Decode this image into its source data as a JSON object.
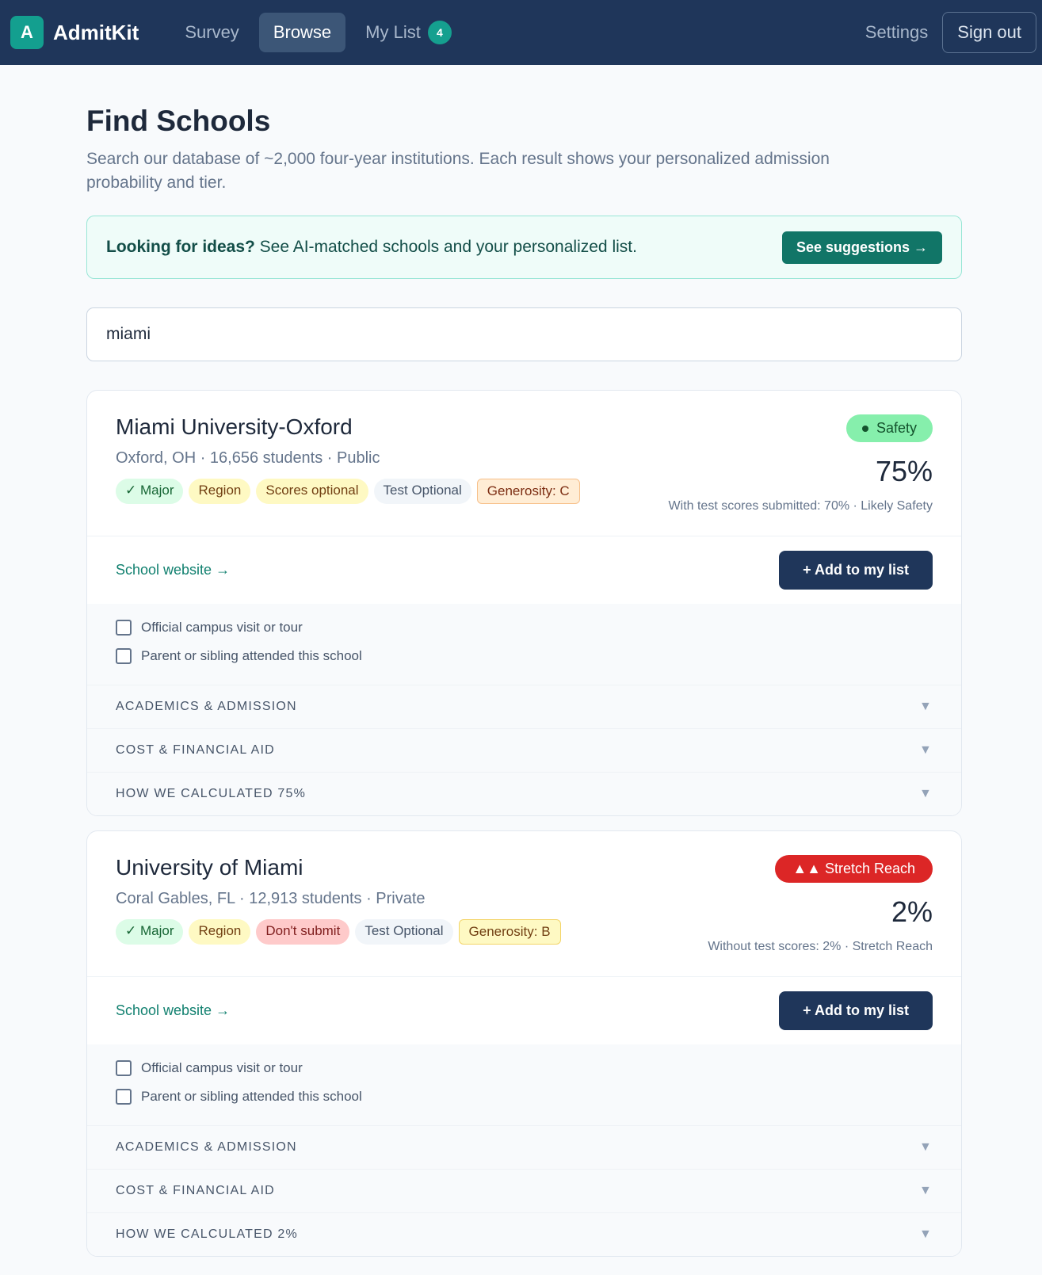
{
  "nav": {
    "logo_letter": "A",
    "brand": "AdmitKit",
    "links": [
      {
        "label": "Survey"
      },
      {
        "label": "Browse"
      },
      {
        "label": "My List",
        "count": "4"
      }
    ],
    "settings": "Settings",
    "signout": "Sign out"
  },
  "page": {
    "title": "Find Schools",
    "subtitle": "Search our database of ~2,000 four-year institutions. Each result shows your personalized admission probability and tier."
  },
  "ideas": {
    "lead": "Looking for ideas?",
    "text": " See AI-matched schools and your personalized list.",
    "button": "See suggestions →"
  },
  "search": {
    "value": "miami"
  },
  "results": [
    {
      "name": "Miami University-Oxford",
      "meta": "Oxford, OH · 16,656 students · Public",
      "tags": [
        "✓ Major",
        "Region",
        "Scores optional",
        "Test Optional",
        "Generosity: C"
      ],
      "tier": "Safety",
      "pct": "75%",
      "note": "With test scores submitted: 70% · Likely Safety",
      "website": "School website →",
      "add": "+ Add to my list",
      "checks": [
        "Official campus visit or tour",
        "Parent or sibling attended this school"
      ],
      "sections": [
        "ACADEMICS & ADMISSION",
        "COST & FINANCIAL AID",
        "HOW WE CALCULATED 75%"
      ],
      "arrow": "▼"
    },
    {
      "name": "University of Miami",
      "meta": "Coral Gables, FL · 12,913 students · Private",
      "tags": [
        "✓ Major",
        "Region",
        "Don't submit",
        "Test Optional",
        "Generosity: B"
      ],
      "tier": "▲▲  Stretch Reach",
      "pct": "2%",
      "note": "Without test scores: 2% · Stretch Reach",
      "website": "School website →",
      "add": "+ Add to my list",
      "checks": [
        "Official campus visit or tour",
        "Parent or sibling attended this school"
      ],
      "sections": [
        "ACADEMICS & ADMISSION",
        "COST & FINANCIAL AID",
        "HOW WE CALCULATED 2%"
      ],
      "arrow": "▼"
    }
  ]
}
